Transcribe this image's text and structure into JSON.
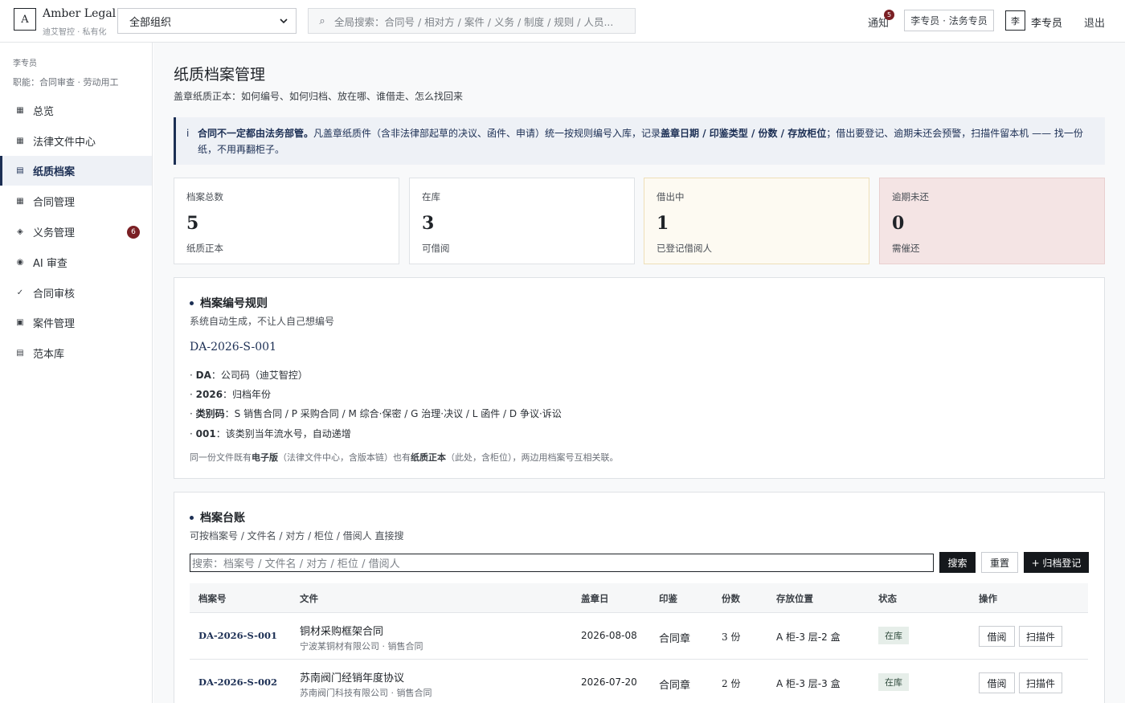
{
  "header": {
    "logo_letter": "A",
    "brand_name": "Amber Legal",
    "brand_sub": "迪艾智控 · 私有化",
    "org_select": "全部组织",
    "search_placeholder": "全局搜索：合同号 / 相对方 / 案件 / 义务 / 制度 / 规则 / 人员...",
    "notify_label": "通知",
    "notify_count": "5",
    "role_label": "李专员 · 法务专员",
    "avatar_letter": "李",
    "user_name": "李专员",
    "logout_label": "退出"
  },
  "sidebar": {
    "user": "李专员",
    "func": "职能：合同审查 · 劳动用工",
    "items": [
      {
        "label": "总览",
        "icon": "grid-icon"
      },
      {
        "label": "法律文件中心",
        "icon": "grid-icon"
      },
      {
        "label": "纸质档案",
        "icon": "list-icon",
        "active": true
      },
      {
        "label": "合同管理",
        "icon": "grid-icon"
      },
      {
        "label": "义务管理",
        "icon": "diamond-icon",
        "badge": "6"
      },
      {
        "label": "AI 审查",
        "icon": "target-icon"
      },
      {
        "label": "合同审核",
        "icon": "check-icon"
      },
      {
        "label": "案件管理",
        "icon": "box-icon"
      },
      {
        "label": "范本库",
        "icon": "list-icon"
      }
    ]
  },
  "page": {
    "title": "纸质档案管理",
    "subtitle": "盖章纸质正本：如何编号、如何归档、放在哪、谁借走、怎么找回来"
  },
  "notice": {
    "icon": "i",
    "bold1": "合同不一定都由法务部管。",
    "text1": "凡盖章纸质件（含非法律部起草的决议、函件、申请）统一按规则编号入库，记录",
    "bold2": "盖章日期 / 印鉴类型 / 份数 / 存放柜位",
    "text2": "；借出要登记、逾期未还会预警，扫描件留本机 —— 找一份纸，不用再翻柜子。"
  },
  "stats": [
    {
      "label": "档案总数",
      "value": "5",
      "sub": "纸质正本"
    },
    {
      "label": "在库",
      "value": "3",
      "sub": "可借阅"
    },
    {
      "label": "借出中",
      "value": "1",
      "sub": "已登记借阅人"
    },
    {
      "label": "逾期未还",
      "value": "0",
      "sub": "需催还"
    }
  ],
  "rules": {
    "title": "档案编号规则",
    "subtitle": "系统自动生成，不让人自己想编号",
    "sample": "DA-2026-S-001",
    "lines": [
      {
        "key": "DA",
        "desc": "：公司码（迪艾智控）"
      },
      {
        "key": "2026",
        "desc": "：归档年份"
      },
      {
        "key": "类别码",
        "desc": "：S 销售合同 / P 采购合同 / M 综合·保密 / G 治理·决议 / L 函件 / D 争议·诉讼"
      },
      {
        "key": "001",
        "desc": "：该类别当年流水号，自动递增"
      }
    ],
    "foot_a": "同一份文件既有",
    "foot_b": "电子版",
    "foot_c": "（法律文件中心，含版本链）也有",
    "foot_d": "纸质正本",
    "foot_e": "（此处，含柜位），两边用档案号互相关联。"
  },
  "ledger": {
    "title": "档案台账",
    "subtitle": "可按档案号 / 文件名 / 对方 / 柜位 / 借阅人 直接搜",
    "search_placeholder": "搜索：档案号 / 文件名 / 对方 / 柜位 / 借阅人",
    "search_btn": "搜索",
    "reset_btn": "重置",
    "add_btn": "+ 归档登记",
    "columns": [
      "档案号",
      "文件",
      "盖章日",
      "印鉴",
      "份数",
      "存放位置",
      "状态",
      "操作"
    ],
    "rows": [
      {
        "code": "DA-2026-S-001",
        "name": "铜材采购框架合同",
        "meta": "宁波某铜材有限公司 · 销售合同",
        "date": "2026-08-08",
        "seal": "合同章",
        "copies": "3 份",
        "location": "A 柜-3 层-2 盒",
        "status": "在库",
        "act1": "借阅",
        "act2": "扫描件"
      },
      {
        "code": "DA-2026-S-002",
        "name": "苏南阀门经销年度协议",
        "meta": "苏南阀门科技有限公司 · 销售合同",
        "date": "2026-07-20",
        "seal": "合同章",
        "copies": "2 份",
        "location": "A 柜-3 层-3 盒",
        "status": "在库",
        "act1": "借阅",
        "act2": "扫描件"
      }
    ]
  }
}
